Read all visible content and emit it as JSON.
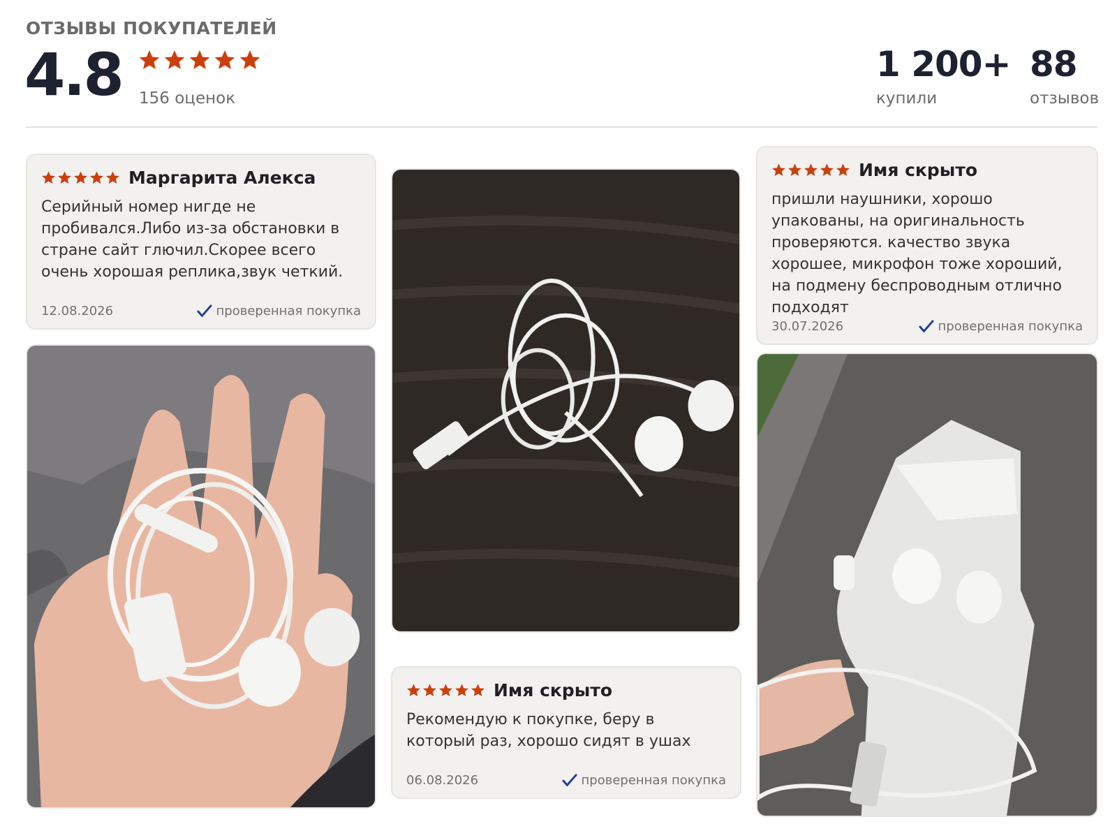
{
  "summary": {
    "title": "ОТЗЫВЫ ПОКУПАТЕЛЕЙ",
    "score": "4.8",
    "stars": 5,
    "ratings_count": "156 оценок",
    "bought_value": "1 200+",
    "bought_label": "купили",
    "reviews_value": "88",
    "reviews_label": "отзывов"
  },
  "colors": {
    "star": "#cc3f0c",
    "check": "#1d3f8f"
  },
  "reviews": [
    {
      "author": "Маргарита Алекса",
      "stars": 5,
      "text": "Серийный номер нигде не пробивался.Либо из-за обстановки в стране сайт глючил.Скорее всего очень хорошая реплика,звук четкий.",
      "date": "12.08.2026",
      "verified": "проверенная покупка",
      "verified_icon": "checkmark-icon"
    },
    {
      "author": "Имя скрыто",
      "stars": 5,
      "text": "пришли наушники, хорошо упакованы, на оригинальность проверяются. качество звука хорошее, микрофон тоже хороший, на подмену беспроводным отлично подходят",
      "date": "30.07.2026",
      "verified": "проверенная покупка",
      "verified_icon": "checkmark-icon"
    },
    {
      "author": "Имя скрыто",
      "stars": 5,
      "text": "Рекомендую к покупке, беру в который раз, хорошо сидят в ушах",
      "date": "06.08.2026",
      "verified": "проверенная покупка",
      "verified_icon": "checkmark-icon"
    }
  ]
}
